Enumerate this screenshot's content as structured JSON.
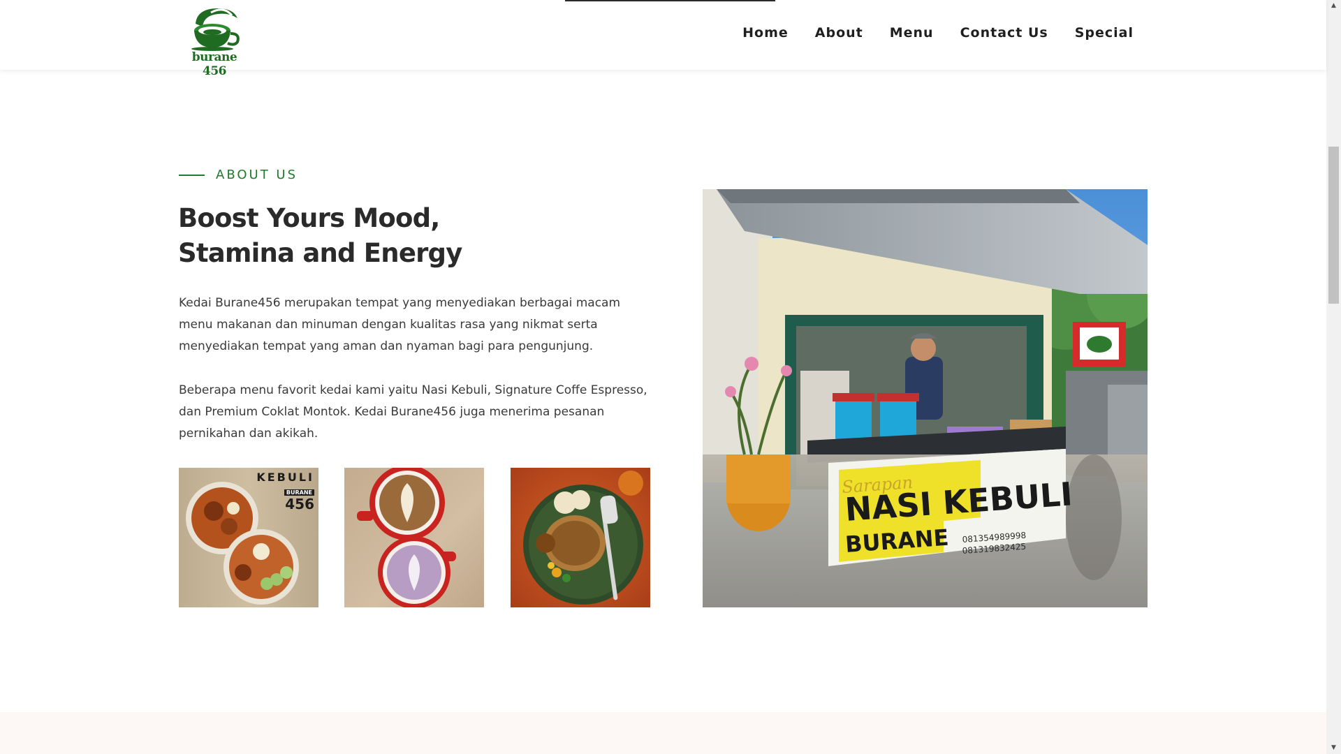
{
  "header": {
    "logo_text": "burane 456",
    "nav": [
      "Home",
      "About",
      "Menu",
      "Contact Us",
      "Special"
    ]
  },
  "about": {
    "eyebrow": "ABOUT US",
    "headline_line1": "Boost Yours Mood,",
    "headline_line2": "Stamina and Energy",
    "paragraph1": "Kedai Burane456 merupakan tempat yang menyediakan berbagai macam menu makanan dan minuman dengan kualitas rasa yang nikmat serta menyediakan tempat yang aman dan nyaman bagi para pengunjung.",
    "paragraph2": "Beberapa menu favorit kedai kami yaitu Nasi Kebuli, Signature Coffe Espresso, dan Premium Coklat Montok. Kedai Burane456 juga menerima pesanan pernikahan dan akikah."
  },
  "thumbnails": [
    {
      "name": "nasi-kebuli-photo",
      "overlay_text": [
        "KEBULI",
        "BURANE",
        "456"
      ]
    },
    {
      "name": "coffee-latte-photo"
    },
    {
      "name": "nasi-plate-photo"
    }
  ],
  "hero": {
    "banner_line1": "Sarapan",
    "banner_line2": "NASI KEBULI",
    "banner_line3": "BURANE",
    "phone1": "081354989998",
    "phone2": "081319832425"
  },
  "colors": {
    "accent": "#1e7a2c",
    "text": "#2b2b2b",
    "footer_band": "#fdf7f5"
  },
  "icons": {
    "scroll_up": "▲",
    "scroll_down": "▼"
  }
}
